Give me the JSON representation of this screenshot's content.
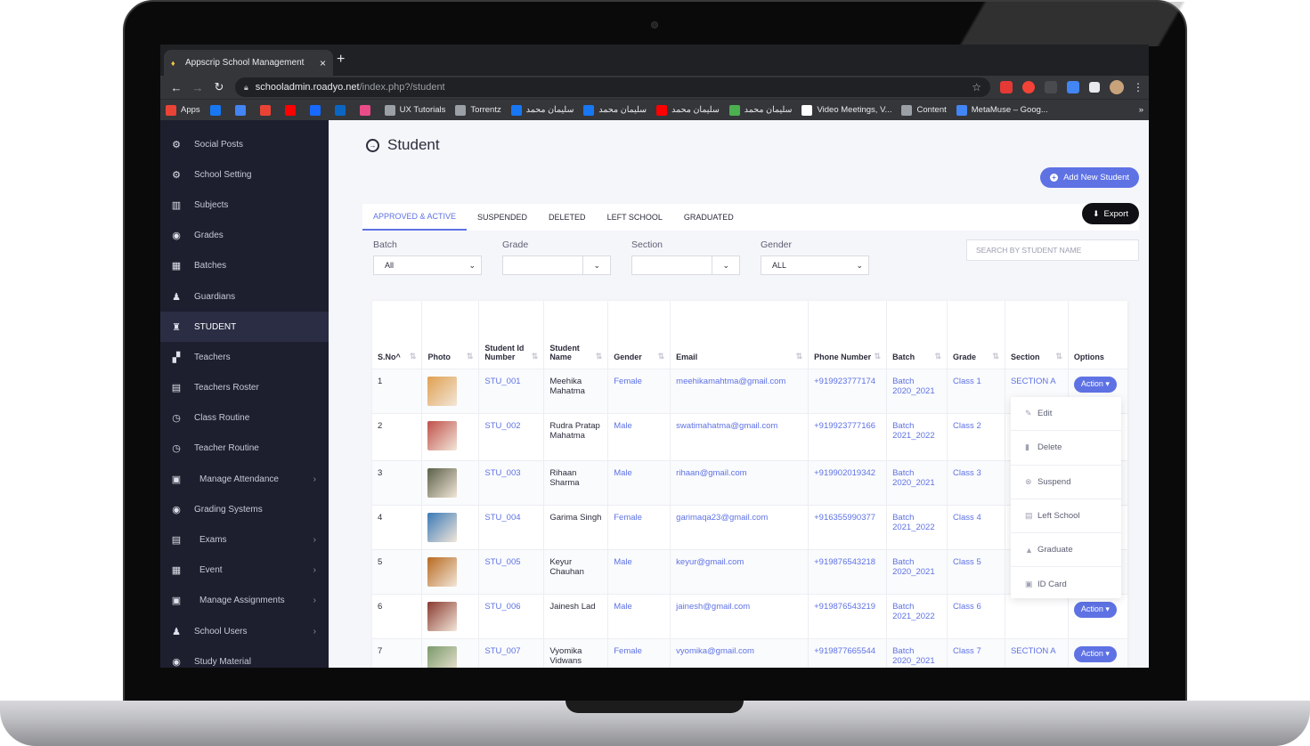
{
  "browser": {
    "tab_title": "Appscrip School Management",
    "url_host": "schooladmin.roadyo.net",
    "url_path": "/index.php?/student",
    "bookmarks": [
      {
        "label": "Apps",
        "color": "#ea4335"
      },
      {
        "label": "",
        "color": "#1877f2"
      },
      {
        "label": "",
        "color": "#4285f4"
      },
      {
        "label": "",
        "color": "#ea4335"
      },
      {
        "label": "",
        "color": "#ff0000"
      },
      {
        "label": "",
        "color": "#1769ff"
      },
      {
        "label": "",
        "color": "#0a66c2"
      },
      {
        "label": "",
        "color": "#ea4c89"
      },
      {
        "label": "UX Tutorials",
        "color": "#9aa0a6"
      },
      {
        "label": "Torrentz",
        "color": "#9aa0a6"
      },
      {
        "label": "سليمان محمد",
        "color": "#1877f2"
      },
      {
        "label": "سليمان محمد",
        "color": "#1877f2"
      },
      {
        "label": "سليمان محمد",
        "color": "#ff0000"
      },
      {
        "label": "سليمان محمد",
        "color": "#4caf50"
      },
      {
        "label": "Video Meetings, V...",
        "color": "#ffffff"
      },
      {
        "label": "Content",
        "color": "#9aa0a6"
      },
      {
        "label": "MetaMuse – Goog...",
        "color": "#4285f4"
      }
    ]
  },
  "sidebar": {
    "items": [
      {
        "label": "Social Posts",
        "icon": "⚙"
      },
      {
        "label": "School Setting",
        "icon": "⚙"
      },
      {
        "label": "Subjects",
        "icon": "▥"
      },
      {
        "label": "Grades",
        "icon": "◉"
      },
      {
        "label": "Batches",
        "icon": "▦"
      },
      {
        "label": "Guardians",
        "icon": "♟"
      },
      {
        "label": "STUDENT",
        "icon": "♜"
      },
      {
        "label": "Teachers",
        "icon": "▞"
      },
      {
        "label": "Teachers Roster",
        "icon": "▤"
      },
      {
        "label": "Class Routine",
        "icon": "◷"
      },
      {
        "label": "Teacher Routine",
        "icon": "◷"
      },
      {
        "label": "Manage Attendance",
        "icon": "▣"
      },
      {
        "label": "Grading Systems",
        "icon": "◉"
      },
      {
        "label": "Exams",
        "icon": "▤"
      },
      {
        "label": "Event",
        "icon": "▦"
      },
      {
        "label": "Manage Assignments",
        "icon": "▣"
      },
      {
        "label": "School Users",
        "icon": "♟"
      },
      {
        "label": "Study Material",
        "icon": "◉"
      }
    ]
  },
  "page": {
    "title": "Student",
    "add_button": "Add New Student",
    "export_button": "Export",
    "tabs": [
      "APPROVED & ACTIVE",
      "SUSPENDED",
      "DELETED",
      "LEFT SCHOOL",
      "GRADUATED"
    ],
    "filters": {
      "batch": {
        "label": "Batch",
        "value": "All"
      },
      "grade": {
        "label": "Grade",
        "value": ""
      },
      "section": {
        "label": "Section",
        "value": ""
      },
      "gender": {
        "label": "Gender",
        "value": "ALL"
      },
      "search_placeholder": "SEARCH BY STUDENT NAME"
    }
  },
  "table": {
    "headers": [
      "S.No^",
      "Photo",
      "Student Id Number",
      "Student Name",
      "Gender",
      "Email",
      "Phone Number",
      "Batch",
      "Grade",
      "Section",
      "Options"
    ],
    "rows": [
      {
        "sno": "1",
        "photo": "#e0a050",
        "id": "STU_001",
        "name": "Meehika Mahatma",
        "gender": "Female",
        "email": "meehikamahtma@gmail.com",
        "phone": "+919923777174",
        "batch": "Batch 2020_2021",
        "grade": "Class 1",
        "section": "SECTION A",
        "action": "Action ▾"
      },
      {
        "sno": "2",
        "photo": "#c0504a",
        "id": "STU_002",
        "name": "Rudra Pratap Mahatma",
        "gender": "Male",
        "email": "swatimahatma@gmail.com",
        "phone": "+919923777166",
        "batch": "Batch 2021_2022",
        "grade": "Class 2",
        "section": "",
        "action": ""
      },
      {
        "sno": "3",
        "photo": "#5a6048",
        "id": "STU_003",
        "name": "Rihaan Sharma",
        "gender": "Male",
        "email": "rihaan@gmail.com",
        "phone": "+919902019342",
        "batch": "Batch 2020_2021",
        "grade": "Class 3",
        "section": "",
        "action": ""
      },
      {
        "sno": "4",
        "photo": "#3a7ab8",
        "id": "STU_004",
        "name": "Garima Singh",
        "gender": "Female",
        "email": "garimaqa23@gmail.com",
        "phone": "+916355990377",
        "batch": "Batch 2021_2022",
        "grade": "Class 4",
        "section": "",
        "action": ""
      },
      {
        "sno": "5",
        "photo": "#b86a20",
        "id": "STU_005",
        "name": "Keyur Chauhan",
        "gender": "Male",
        "email": "keyur@gmail.com",
        "phone": "+919876543218",
        "batch": "Batch 2020_2021",
        "grade": "Class 5",
        "section": "",
        "action": ""
      },
      {
        "sno": "6",
        "photo": "#8a3a30",
        "id": "STU_006",
        "name": "Jainesh Lad",
        "gender": "Male",
        "email": "jainesh@gmail.com",
        "phone": "+919876543219",
        "batch": "Batch 2021_2022",
        "grade": "Class 6",
        "section": "",
        "action": "Action ▾"
      },
      {
        "sno": "7",
        "photo": "#7a9a6a",
        "id": "STU_007",
        "name": "Vyomika Vidwans",
        "gender": "Female",
        "email": "vyomika@gmail.com",
        "phone": "+919877665544",
        "batch": "Batch 2020_2021",
        "grade": "Class 7",
        "section": "SECTION A",
        "action": "Action ▾"
      }
    ]
  },
  "action_menu": [
    {
      "label": "Edit",
      "icon": "✎"
    },
    {
      "label": "Delete",
      "icon": "▮"
    },
    {
      "label": "Suspend",
      "icon": "⊗"
    },
    {
      "label": "Left School",
      "icon": "▤"
    },
    {
      "label": "Graduate",
      "icon": "▲"
    },
    {
      "label": "ID Card",
      "icon": "▣"
    }
  ],
  "colors": {
    "accent": "#5e72e4",
    "sidebar": "#1d1f2f"
  }
}
